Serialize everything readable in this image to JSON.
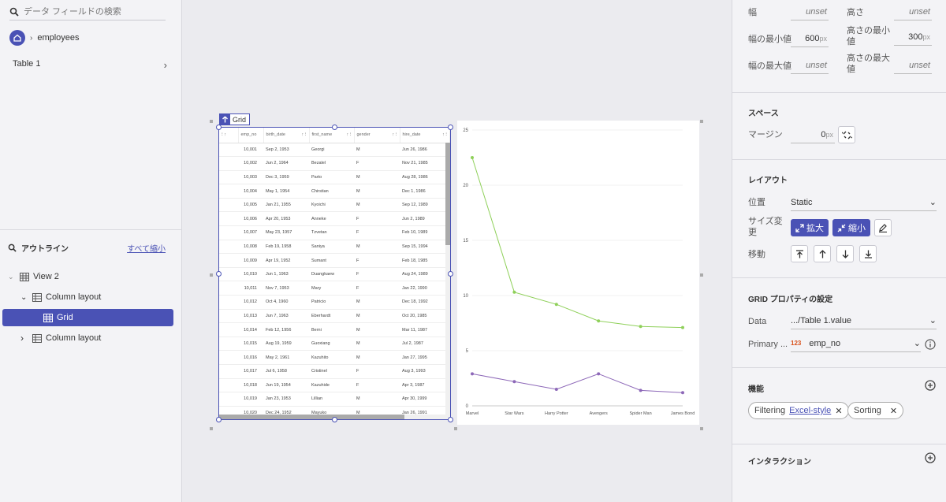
{
  "left": {
    "search_placeholder": "データ フィールドの検索",
    "breadcrumb": "employees",
    "table_item": "Table 1",
    "outline_title": "アウトライン",
    "collapse_all": "すべて縮小",
    "tree": [
      {
        "label": "View 2"
      },
      {
        "label": "Column layout"
      },
      {
        "label": "Grid"
      },
      {
        "label": "Column layout"
      }
    ]
  },
  "grid": {
    "badge": "Grid",
    "columns": [
      "emp_no",
      "birth_date",
      "first_name",
      "gender",
      "hire_date"
    ],
    "rows": [
      [
        "10,001",
        "Sep 2, 1953",
        "Georgi",
        "M",
        "Jun 26, 1986"
      ],
      [
        "10,002",
        "Jun 2, 1964",
        "Bezalel",
        "F",
        "Nov 21, 1985"
      ],
      [
        "10,003",
        "Dec 3, 1959",
        "Parto",
        "M",
        "Aug 28, 1986"
      ],
      [
        "10,004",
        "May 1, 1954",
        "Chirstian",
        "M",
        "Dec 1, 1986"
      ],
      [
        "10,005",
        "Jan 21, 1955",
        "Kyoichi",
        "M",
        "Sep 12, 1989"
      ],
      [
        "10,006",
        "Apr 20, 1953",
        "Anneke",
        "F",
        "Jun 2, 1989"
      ],
      [
        "10,007",
        "May 23, 1957",
        "Tzvetan",
        "F",
        "Feb 10, 1989"
      ],
      [
        "10,008",
        "Feb 19, 1958",
        "Saniya",
        "M",
        "Sep 15, 1994"
      ],
      [
        "10,009",
        "Apr 19, 1952",
        "Sumant",
        "F",
        "Feb 18, 1985"
      ],
      [
        "10,010",
        "Jun 1, 1963",
        "Duangkaew",
        "F",
        "Aug 24, 1989"
      ],
      [
        "10,011",
        "Nov 7, 1953",
        "Mary",
        "F",
        "Jan 22, 1990"
      ],
      [
        "10,012",
        "Oct 4, 1960",
        "Patricio",
        "M",
        "Dec 18, 1992"
      ],
      [
        "10,013",
        "Jun 7, 1963",
        "Eberhardt",
        "M",
        "Oct 20, 1985"
      ],
      [
        "10,014",
        "Feb 12, 1956",
        "Berni",
        "M",
        "Mar 11, 1987"
      ],
      [
        "10,015",
        "Aug 19, 1959",
        "Guoxiang",
        "M",
        "Jul 2, 1987"
      ],
      [
        "10,016",
        "May 2, 1961",
        "Kazuhito",
        "M",
        "Jan 27, 1995"
      ],
      [
        "10,017",
        "Jul 6, 1958",
        "Cristinel",
        "F",
        "Aug 3, 1993"
      ],
      [
        "10,018",
        "Jun 19, 1954",
        "Kazuhide",
        "F",
        "Apr 3, 1987"
      ],
      [
        "10,019",
        "Jan 23, 1953",
        "Lillian",
        "M",
        "Apr 30, 1999"
      ],
      [
        "10,020",
        "Dec 24, 1952",
        "Mayuko",
        "M",
        "Jan 26, 1991"
      ]
    ]
  },
  "chart_data": {
    "type": "line",
    "categories": [
      "Marvel",
      "Star Wars",
      "Harry Potter",
      "Avengers",
      "Spider Man",
      "James Bond"
    ],
    "series": [
      {
        "values": [
          22.5,
          10.3,
          9.2,
          7.7,
          7.2,
          7.1
        ],
        "color": "#8fd05a"
      },
      {
        "values": [
          2.9,
          2.2,
          1.5,
          2.9,
          1.4,
          1.2
        ],
        "color": "#8d68b8"
      }
    ],
    "yticks": [
      0,
      5,
      10,
      15,
      20,
      25
    ],
    "ylim": [
      0,
      25
    ],
    "grid": true
  },
  "right": {
    "width_label": "幅",
    "width_value": "unset",
    "height_label": "高さ",
    "height_value": "unset",
    "min_width_label": "幅の最小値",
    "min_width_value": "600",
    "min_width_unit": "px",
    "min_height_label": "高さの最小値",
    "min_height_value": "300",
    "min_height_unit": "px",
    "max_width_label": "幅の最大値",
    "max_width_value": "unset",
    "max_height_label": "高さの最大値",
    "max_height_value": "unset",
    "space_title": "スペース",
    "margin_label": "マージン",
    "margin_value": "0",
    "margin_unit": "px",
    "layout_title": "レイアウト",
    "position_label": "位置",
    "position_value": "Static",
    "resize_label": "サイズ変更",
    "expand_label": "拡大",
    "shrink_label": "縮小",
    "move_label": "移動",
    "grid_props_title": "GRID プロパティの設定",
    "data_label": "Data",
    "data_value": ".../Table 1.value",
    "primary_label": "Primary ...",
    "primary_type": "123",
    "primary_value": "emp_no",
    "features_title": "機能",
    "filtering_label": "Filtering",
    "filtering_mode": "Excel-style",
    "sorting_label": "Sorting",
    "interaction_title": "インタラクション",
    "accent": "#4a52b5"
  }
}
